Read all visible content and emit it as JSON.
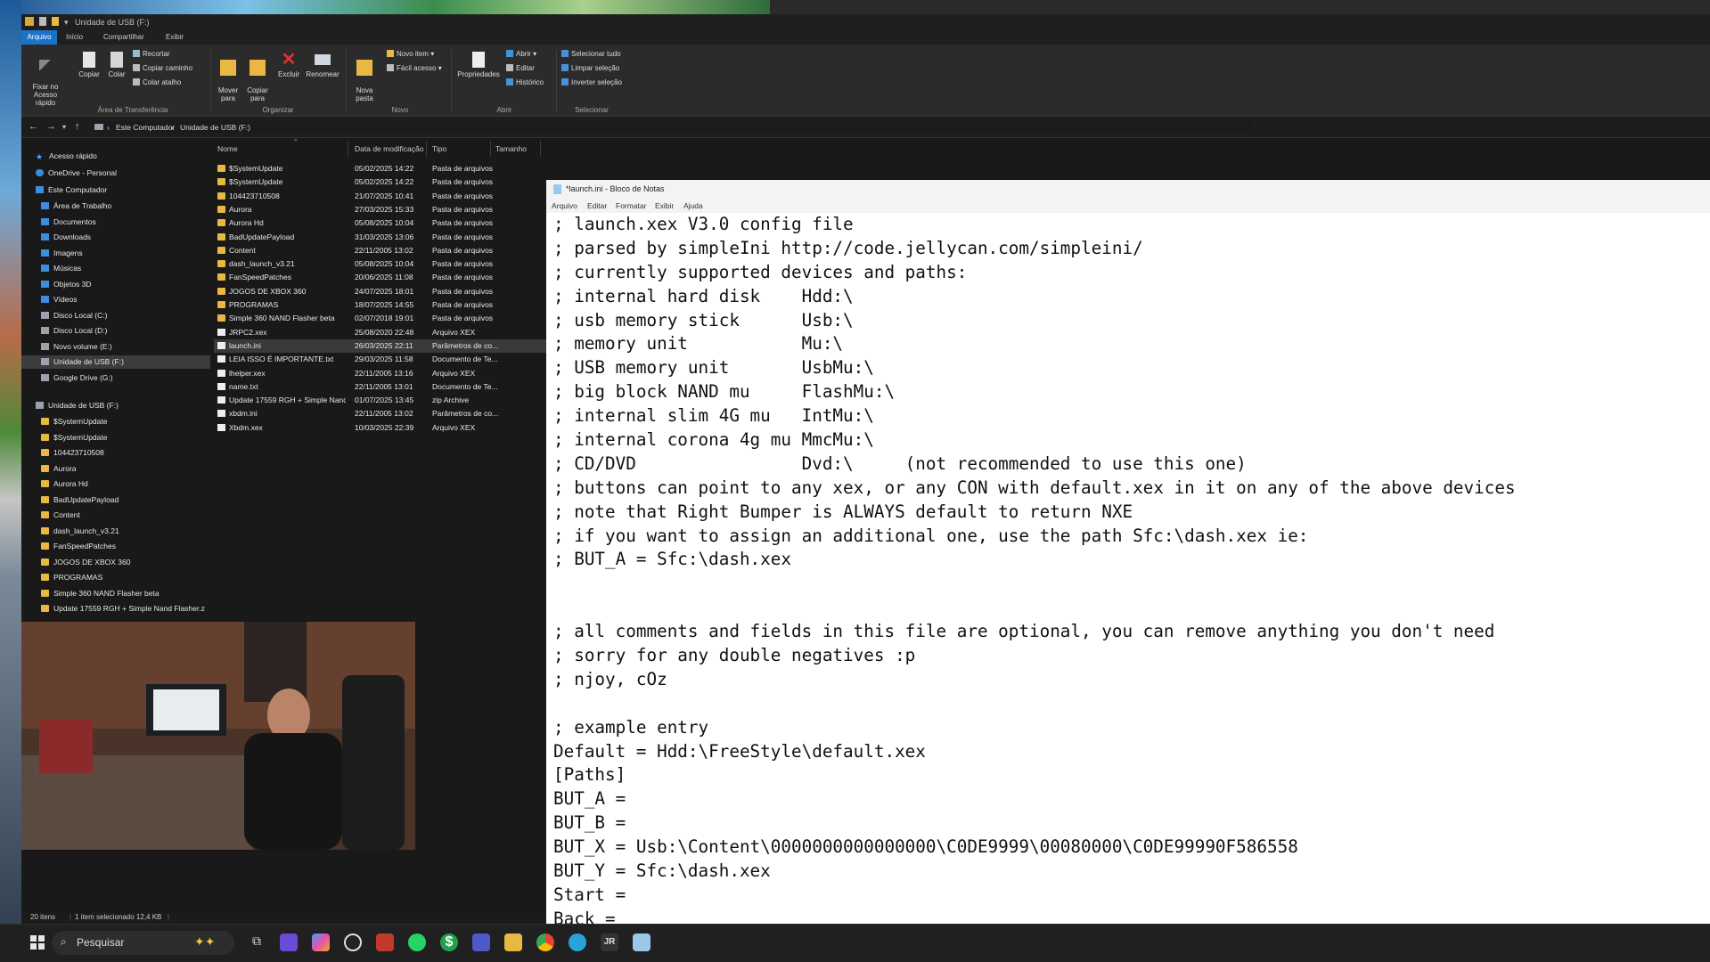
{
  "explorer": {
    "title": "Unidade de USB (F:)",
    "tabs": [
      "Arquivo",
      "Início",
      "Compartilhar",
      "Exibir"
    ],
    "ribbon": {
      "pin_label": "Fixar no\nAcesso rápido",
      "copy_label": "Copiar",
      "paste_label": "Colar",
      "cut_label": "Recortar",
      "copy_path_label": "Copiar caminho",
      "paste_shortcut_label": "Colar atalho",
      "group_clipboard": "Área de Transferência",
      "move_label": "Mover\npara",
      "copyto_label": "Copiar\npara",
      "delete_label": "Excluir",
      "rename_label": "Renomear",
      "group_organize": "Organizar",
      "newfolder_label": "Nova\npasta",
      "newitem_label": "Novo item",
      "easyaccess_label": "Fácil acesso",
      "group_new": "Novo",
      "properties_label": "Propriedades",
      "open_label": "Abrir",
      "edit_label": "Editar",
      "history_label": "Histórico",
      "group_open": "Abrir",
      "select_all_label": "Selecionar tudo",
      "clear_selection_label": "Limpar seleção",
      "invert_selection_label": "Inverter seleção",
      "group_select": "Selecionar"
    },
    "breadcrumb": [
      "Este Computador",
      "Unidade de USB (F:)"
    ],
    "nav": {
      "quick_access": "Acesso rápido",
      "onedrive": "OneDrive - Personal",
      "this_pc": "Este Computador",
      "pc_items": [
        "Área de Trabalho",
        "Documentos",
        "Downloads",
        "Imagens",
        "Músicas",
        "Objetos 3D",
        "Vídeos",
        "Disco Local (C:)",
        "Disco Local (D:)",
        "Novo volume (E:)",
        "Unidade de USB (F:)",
        "Google Drive (G:)"
      ],
      "usb_root": "Unidade de USB (F:)",
      "usb_items": [
        "$SystemUpdate",
        "$SystemUpdate",
        "104423710508",
        "Aurora",
        "Aurora Hd",
        "BadUpdatePayload",
        "Content",
        "dash_launch_v3.21",
        "FanSpeedPatches",
        "JOGOS DE XBOX 360",
        "PROGRAMAS",
        "Simple 360 NAND Flasher beta",
        "Update 17559 RGH + Simple Nand Flasher.z"
      ]
    },
    "columns": [
      "Nome",
      "Data de modificação",
      "Tipo",
      "Tamanho"
    ],
    "files": [
      {
        "name": "$SystemUpdate",
        "date": "05/02/2025 14:22",
        "type": "Pasta de arquivos",
        "kind": "folder"
      },
      {
        "name": "$SystemUpdate",
        "date": "05/02/2025 14:22",
        "type": "Pasta de arquivos",
        "kind": "folder"
      },
      {
        "name": "104423710508",
        "date": "21/07/2025 10:41",
        "type": "Pasta de arquivos",
        "kind": "folder"
      },
      {
        "name": "Aurora",
        "date": "27/03/2025 15:33",
        "type": "Pasta de arquivos",
        "kind": "folder"
      },
      {
        "name": "Aurora Hd",
        "date": "05/08/2025 10:04",
        "type": "Pasta de arquivos",
        "kind": "folder"
      },
      {
        "name": "BadUpdatePayload",
        "date": "31/03/2025 13:06",
        "type": "Pasta de arquivos",
        "kind": "folder"
      },
      {
        "name": "Content",
        "date": "22/11/2005 13:02",
        "type": "Pasta de arquivos",
        "kind": "folder"
      },
      {
        "name": "dash_launch_v3.21",
        "date": "05/08/2025 10:04",
        "type": "Pasta de arquivos",
        "kind": "folder"
      },
      {
        "name": "FanSpeedPatches",
        "date": "20/06/2025 11:08",
        "type": "Pasta de arquivos",
        "kind": "folder"
      },
      {
        "name": "JOGOS DE XBOX 360",
        "date": "24/07/2025 18:01",
        "type": "Pasta de arquivos",
        "kind": "folder"
      },
      {
        "name": "PROGRAMAS",
        "date": "18/07/2025 14:55",
        "type": "Pasta de arquivos",
        "kind": "folder"
      },
      {
        "name": "Simple 360 NAND Flasher beta",
        "date": "02/07/2018 19:01",
        "type": "Pasta de arquivos",
        "kind": "folder"
      },
      {
        "name": "JRPC2.xex",
        "date": "25/08/2020 22:48",
        "type": "Arquivo XEX",
        "kind": "file"
      },
      {
        "name": "launch.ini",
        "date": "26/03/2025 22:11",
        "type": "Parâmetros de co...",
        "kind": "file",
        "selected": true
      },
      {
        "name": "LEIA ISSO É IMPORTANTE.txt",
        "date": "29/03/2025 11:58",
        "type": "Documento de Te...",
        "kind": "file"
      },
      {
        "name": "lhelper.xex",
        "date": "22/11/2005 13:16",
        "type": "Arquivo XEX",
        "kind": "file"
      },
      {
        "name": "name.txt",
        "date": "22/11/2005 13:01",
        "type": "Documento de Te...",
        "kind": "file"
      },
      {
        "name": "Update 17559 RGH + Simple Nand Flashe...",
        "date": "01/07/2025 13:45",
        "type": "zip Archive",
        "kind": "file"
      },
      {
        "name": "xbdm.ini",
        "date": "22/11/2005 13:02",
        "type": "Parâmetros de co...",
        "kind": "file"
      },
      {
        "name": "Xbdm.xex",
        "date": "10/03/2025 22:39",
        "type": "Arquivo XEX",
        "kind": "file"
      }
    ],
    "status": {
      "count": "20 itens",
      "selected": "1 item selecionado  12,4 KB"
    }
  },
  "notepad": {
    "title": "*launch.ini - Bloco de Notas",
    "menu": [
      "Arquivo",
      "Editar",
      "Formatar",
      "Exibir",
      "Ajuda"
    ],
    "lines": [
      "; launch.xex V3.0 config file",
      "; parsed by simpleIni http://code.jellycan.com/simpleini/",
      "; currently supported devices and paths:",
      "; internal hard disk    Hdd:\\",
      "; usb memory stick      Usb:\\",
      "; memory unit           Mu:\\",
      "; USB memory unit       UsbMu:\\",
      "; big block NAND mu     FlashMu:\\",
      "; internal slim 4G mu   IntMu:\\",
      "; internal corona 4g mu MmcMu:\\",
      "; CD/DVD                Dvd:\\     (not recommended to use this one)",
      "; buttons can point to any xex, or any CON with default.xex in it on any of the above devices",
      "; note that Right Bumper is ALWAYS default to return NXE",
      "; if you want to assign an additional one, use the path Sfc:\\dash.xex ie:",
      "; BUT_A = Sfc:\\dash.xex",
      "",
      "",
      "; all comments and fields in this file are optional, you can remove anything you don't need",
      "; sorry for any double negatives :p",
      "; njoy, cOz",
      "",
      "; example entry",
      "Default = Hdd:\\FreeStyle\\default.xex",
      "[Paths]",
      "BUT_A =",
      "BUT_B =",
      "BUT_X = Usb:\\Content\\0000000000000000\\C0DE9999\\00080000\\C0DE99990F586558",
      "BUT_Y = Sfc:\\dash.xex",
      "Start =",
      "Back ="
    ]
  },
  "taskbar": {
    "search_placeholder": "Pesquisar",
    "icons": [
      "start-icon",
      "copilot-icon",
      "task-view-icon",
      "teams-icon",
      "copilot-app-icon",
      "obs-icon",
      "tool-icon",
      "whatsapp-icon",
      "money-icon",
      "teams-chat-icon",
      "file-explorer-icon",
      "chrome-icon",
      "telegram-icon",
      "jr-icon",
      "notepad-icon"
    ]
  },
  "colors": {
    "accent": "#1a73c9",
    "folder": "#e8b843",
    "dark_bg": "#191919"
  }
}
